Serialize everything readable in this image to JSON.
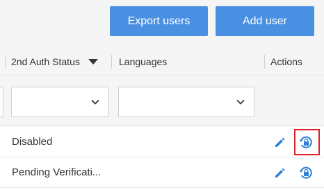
{
  "toolbar": {
    "export_label": "Export users",
    "add_label": "Add user"
  },
  "table": {
    "headers": {
      "auth_status": "2nd Auth Status",
      "languages": "Languages",
      "actions": "Actions"
    },
    "rows": [
      {
        "auth_status": "Disabled"
      },
      {
        "auth_status": "Pending Verificati..."
      }
    ]
  },
  "icons": {
    "sort": "caret-down-icon",
    "dropdown": "chevron-down-icon",
    "edit": "pencil-icon",
    "reset": "lock-reset-icon"
  },
  "colors": {
    "primary": "#4a90e2",
    "icon_blue": "#2f7fd8",
    "highlight": "#e0202a"
  }
}
